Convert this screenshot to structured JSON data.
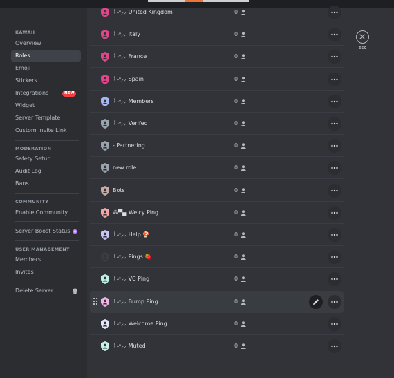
{
  "sidebar": {
    "section_server": "KAWAII",
    "server_items": [
      "Overview",
      "Roles",
      "Emoji",
      "Stickers",
      "Integrations",
      "Widget",
      "Server Template",
      "Custom Invite Link"
    ],
    "new_badge": "NEW",
    "section_moderation": "MODERATION",
    "moderation_items": [
      "Safety Setup",
      "Audit Log",
      "Bans"
    ],
    "section_community": "COMMUNITY",
    "community_items": [
      "Enable Community"
    ],
    "boost_item": "Server Boost Status",
    "section_user_management": "USER MANAGEMENT",
    "user_items": [
      "Members",
      "Invites"
    ],
    "delete_item": "Delete Server",
    "active_item": "Roles"
  },
  "roles": [
    {
      "name": "꒰˶ᐢ⸝⸝ United Kingdom",
      "count": "0",
      "color": "#e3458b"
    },
    {
      "name": "꒰˶ᐢ⸝⸝ Italy",
      "count": "0",
      "color": "#e3458b"
    },
    {
      "name": "꒰˶ᐢ⸝⸝ France",
      "count": "0",
      "color": "#e3458b"
    },
    {
      "name": "꒰˶ᐢ⸝⸝ Spain",
      "count": "0",
      "color": "#e3458b"
    },
    {
      "name": "꒰˶ᐢ⸝⸝ Members",
      "count": "0",
      "color": "#aab6f0"
    },
    {
      "name": "꒰˶ᐢ⸝⸝ Verifed",
      "count": "0",
      "color": "#9aa4ad"
    },
    {
      "name": "- Partnering",
      "count": "0",
      "color": "#9aa4ad"
    },
    {
      "name": "new role",
      "count": "0",
      "color": "#9aa4ad"
    },
    {
      "name": "Bots",
      "count": "0",
      "color": "#c9a7a2"
    },
    {
      "name": "⁂▀▄ Welcy Ping",
      "count": "0",
      "color": "#f4a6a6"
    },
    {
      "name": "꒰˶ᐢ⸝⸝ Help 🍄",
      "count": "0",
      "color": "#c8c6f4"
    },
    {
      "name": "꒰˶ᐢ⸝⸝ Pings 🍓",
      "count": "0",
      "color": "#3a3c42"
    },
    {
      "name": "꒰˶ᐢ⸝⸝ VC Ping",
      "count": "0",
      "color": "#bdf2e2"
    },
    {
      "name": "꒰˶ᐢ⸝⸝ Bump Ping",
      "count": "0",
      "color": "#f0b6e8"
    },
    {
      "name": "꒰˶ᐢ⸝⸝ Welcome Ping",
      "count": "0",
      "color": "#e4e8f8"
    },
    {
      "name": "꒰˶ᐢ⸝⸝ Muted",
      "count": "0",
      "color": "#c6f2ea"
    }
  ],
  "hovered_role_index": 13,
  "esc": {
    "label": "ESC"
  },
  "colors": {
    "new_badge": "#f23f43",
    "boost": "#b473f5"
  }
}
